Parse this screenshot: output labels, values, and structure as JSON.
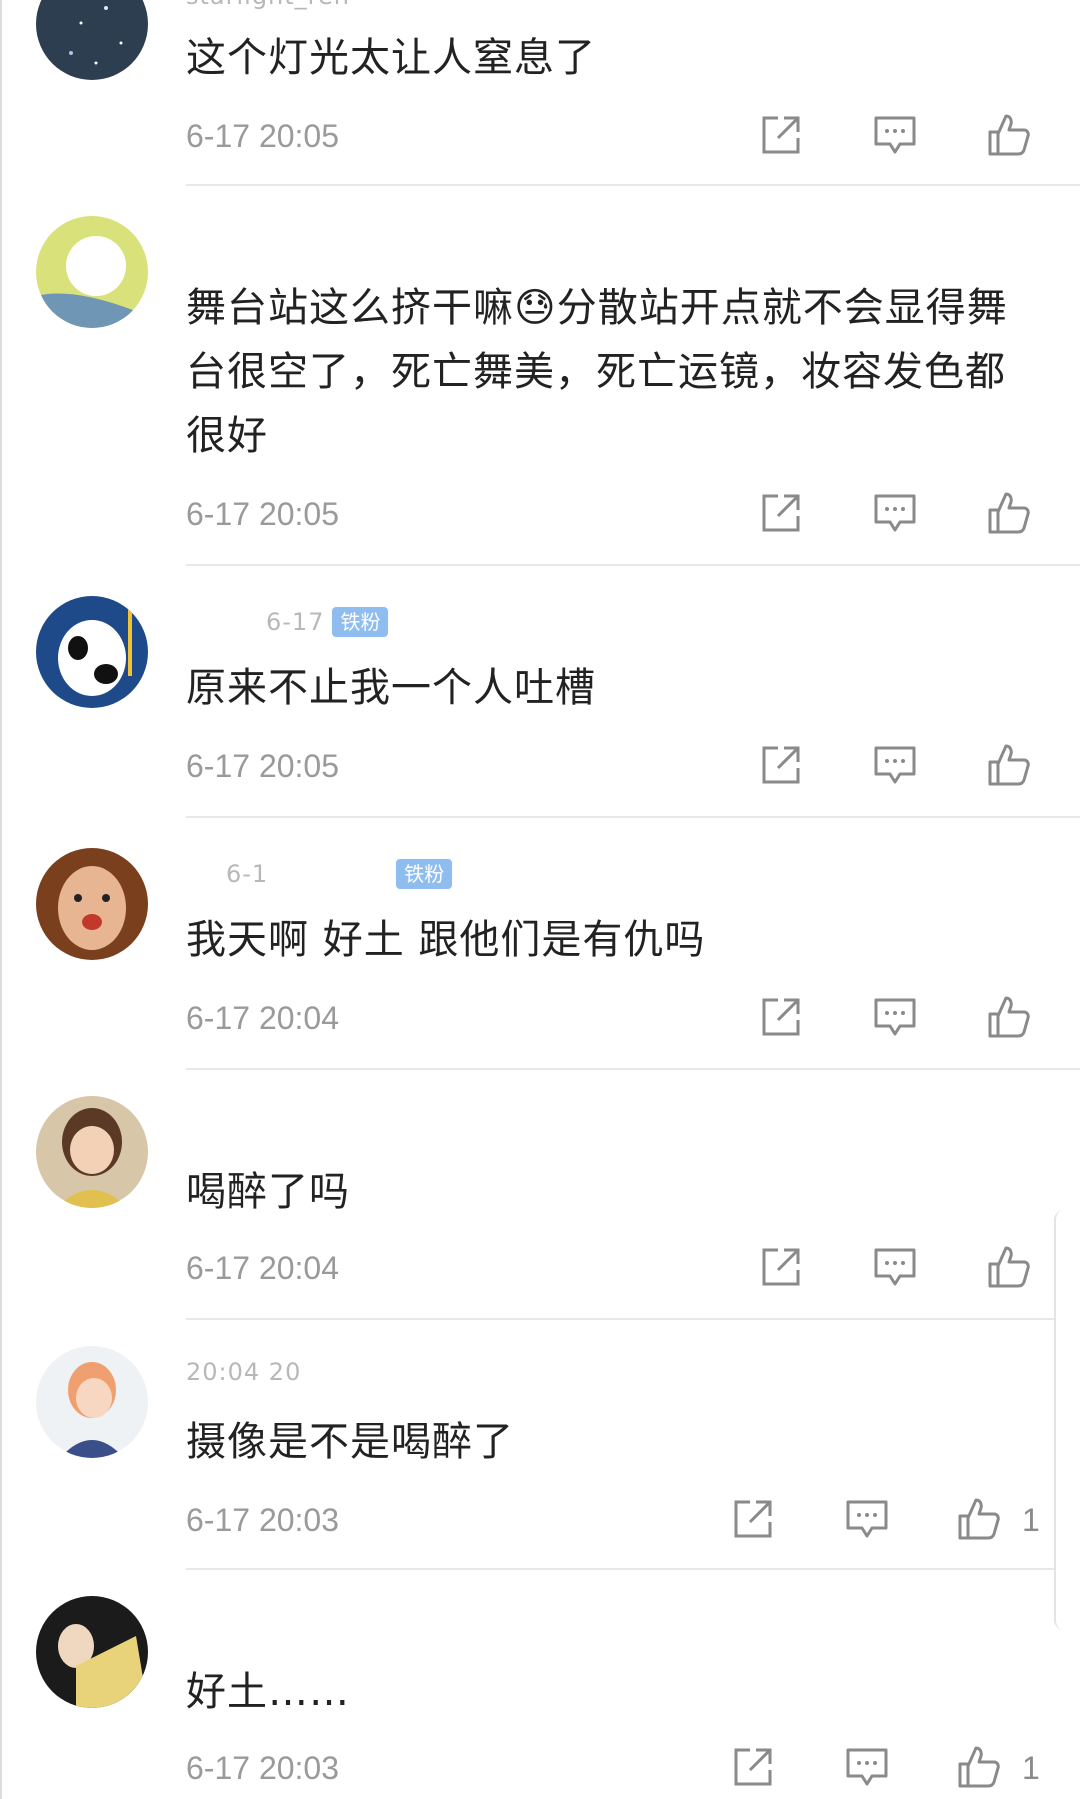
{
  "comments": [
    {
      "username": "starlight_ren",
      "badge": "",
      "text": "这个灯光太让人窒息了",
      "timestamp": "6-17 20:05",
      "likes": ""
    },
    {
      "username": "",
      "badge": "",
      "text": "舞台站这么挤干嘛😓分散站开点就不会显得舞台很空了，死亡舞美，死亡运镜，妆容发色都很好",
      "timestamp": "6-17 20:05",
      "likes": ""
    },
    {
      "username": "6-17",
      "badge": "铁粉",
      "text": "原来不止我一个人吐槽",
      "timestamp": "6-17 20:05",
      "likes": ""
    },
    {
      "username": "6-1",
      "badge": "铁粉",
      "text": "我天啊 好土 跟他们是有仇吗",
      "timestamp": "6-17 20:04",
      "likes": ""
    },
    {
      "username": "",
      "badge": "",
      "text": "喝醉了吗",
      "timestamp": "6-17 20:04",
      "likes": ""
    },
    {
      "username": "20:04 20",
      "badge": "",
      "text": "摄像是不是喝醉了",
      "timestamp": "6-17 20:03",
      "likes": "1"
    },
    {
      "username": "",
      "badge": "",
      "text": "好土……",
      "timestamp": "6-17 20:03",
      "likes": "1"
    }
  ],
  "icons": {
    "share": "share-icon",
    "reply": "comment-icon",
    "like": "thumbs-up-icon"
  },
  "colors": {
    "text": "#222222",
    "meta": "#9a9a9a",
    "badge": "#8fbdf0",
    "divider": "#e8e8e8"
  }
}
